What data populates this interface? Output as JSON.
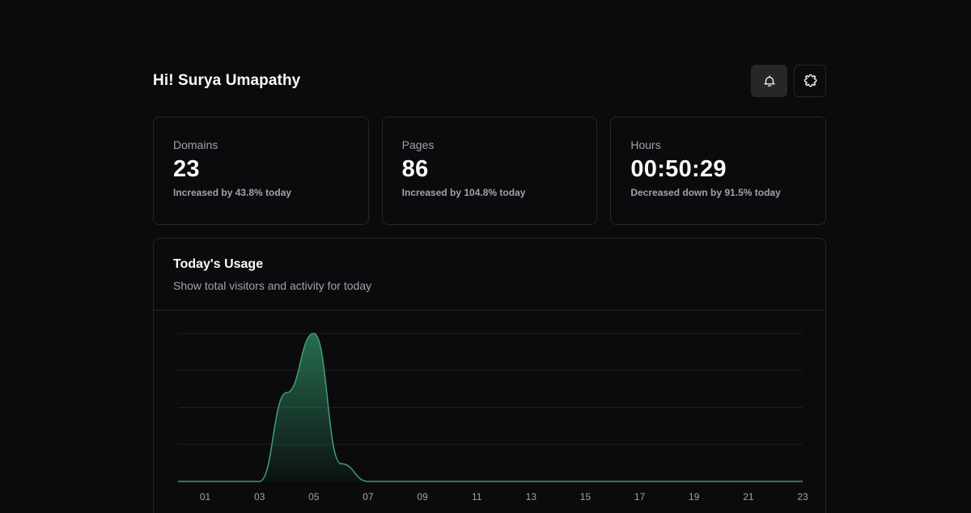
{
  "header": {
    "greeting": "Hi! Surya Umapathy",
    "buttons": [
      {
        "icon": "bell-icon"
      },
      {
        "icon": "puzzle-icon"
      }
    ]
  },
  "stats": [
    {
      "label": "Domains",
      "value": "23",
      "note": "Increased by 43.8% today"
    },
    {
      "label": "Pages",
      "value": "86",
      "note": "Increased by 104.8% today"
    },
    {
      "label": "Hours",
      "value": "00:50:29",
      "note": "Decreased down by 91.5% today"
    }
  ],
  "usage": {
    "title": "Today's Usage",
    "subtitle": "Show total visitors and activity for today"
  },
  "colors": {
    "background": "#0b0b0d",
    "border": "#27272a",
    "accent": "#3f9f73"
  },
  "chart_data": {
    "type": "area",
    "x": [
      "00",
      "01",
      "02",
      "03",
      "04",
      "05",
      "06",
      "07",
      "08",
      "09",
      "10",
      "11",
      "12",
      "13",
      "14",
      "15",
      "16",
      "17",
      "18",
      "19",
      "20",
      "21",
      "22",
      "23"
    ],
    "tick_labels": [
      "01",
      "03",
      "05",
      "07",
      "09",
      "11",
      "13",
      "15",
      "17",
      "19",
      "21",
      "23"
    ],
    "values": [
      0,
      0,
      0,
      0,
      0.6,
      1.0,
      0.12,
      0,
      0,
      0,
      0,
      0,
      0,
      0,
      0,
      0,
      0,
      0,
      0,
      0,
      0,
      0,
      0,
      0
    ],
    "ylim": [
      0,
      1
    ],
    "grid": true,
    "title": "",
    "xlabel": "",
    "ylabel": ""
  }
}
